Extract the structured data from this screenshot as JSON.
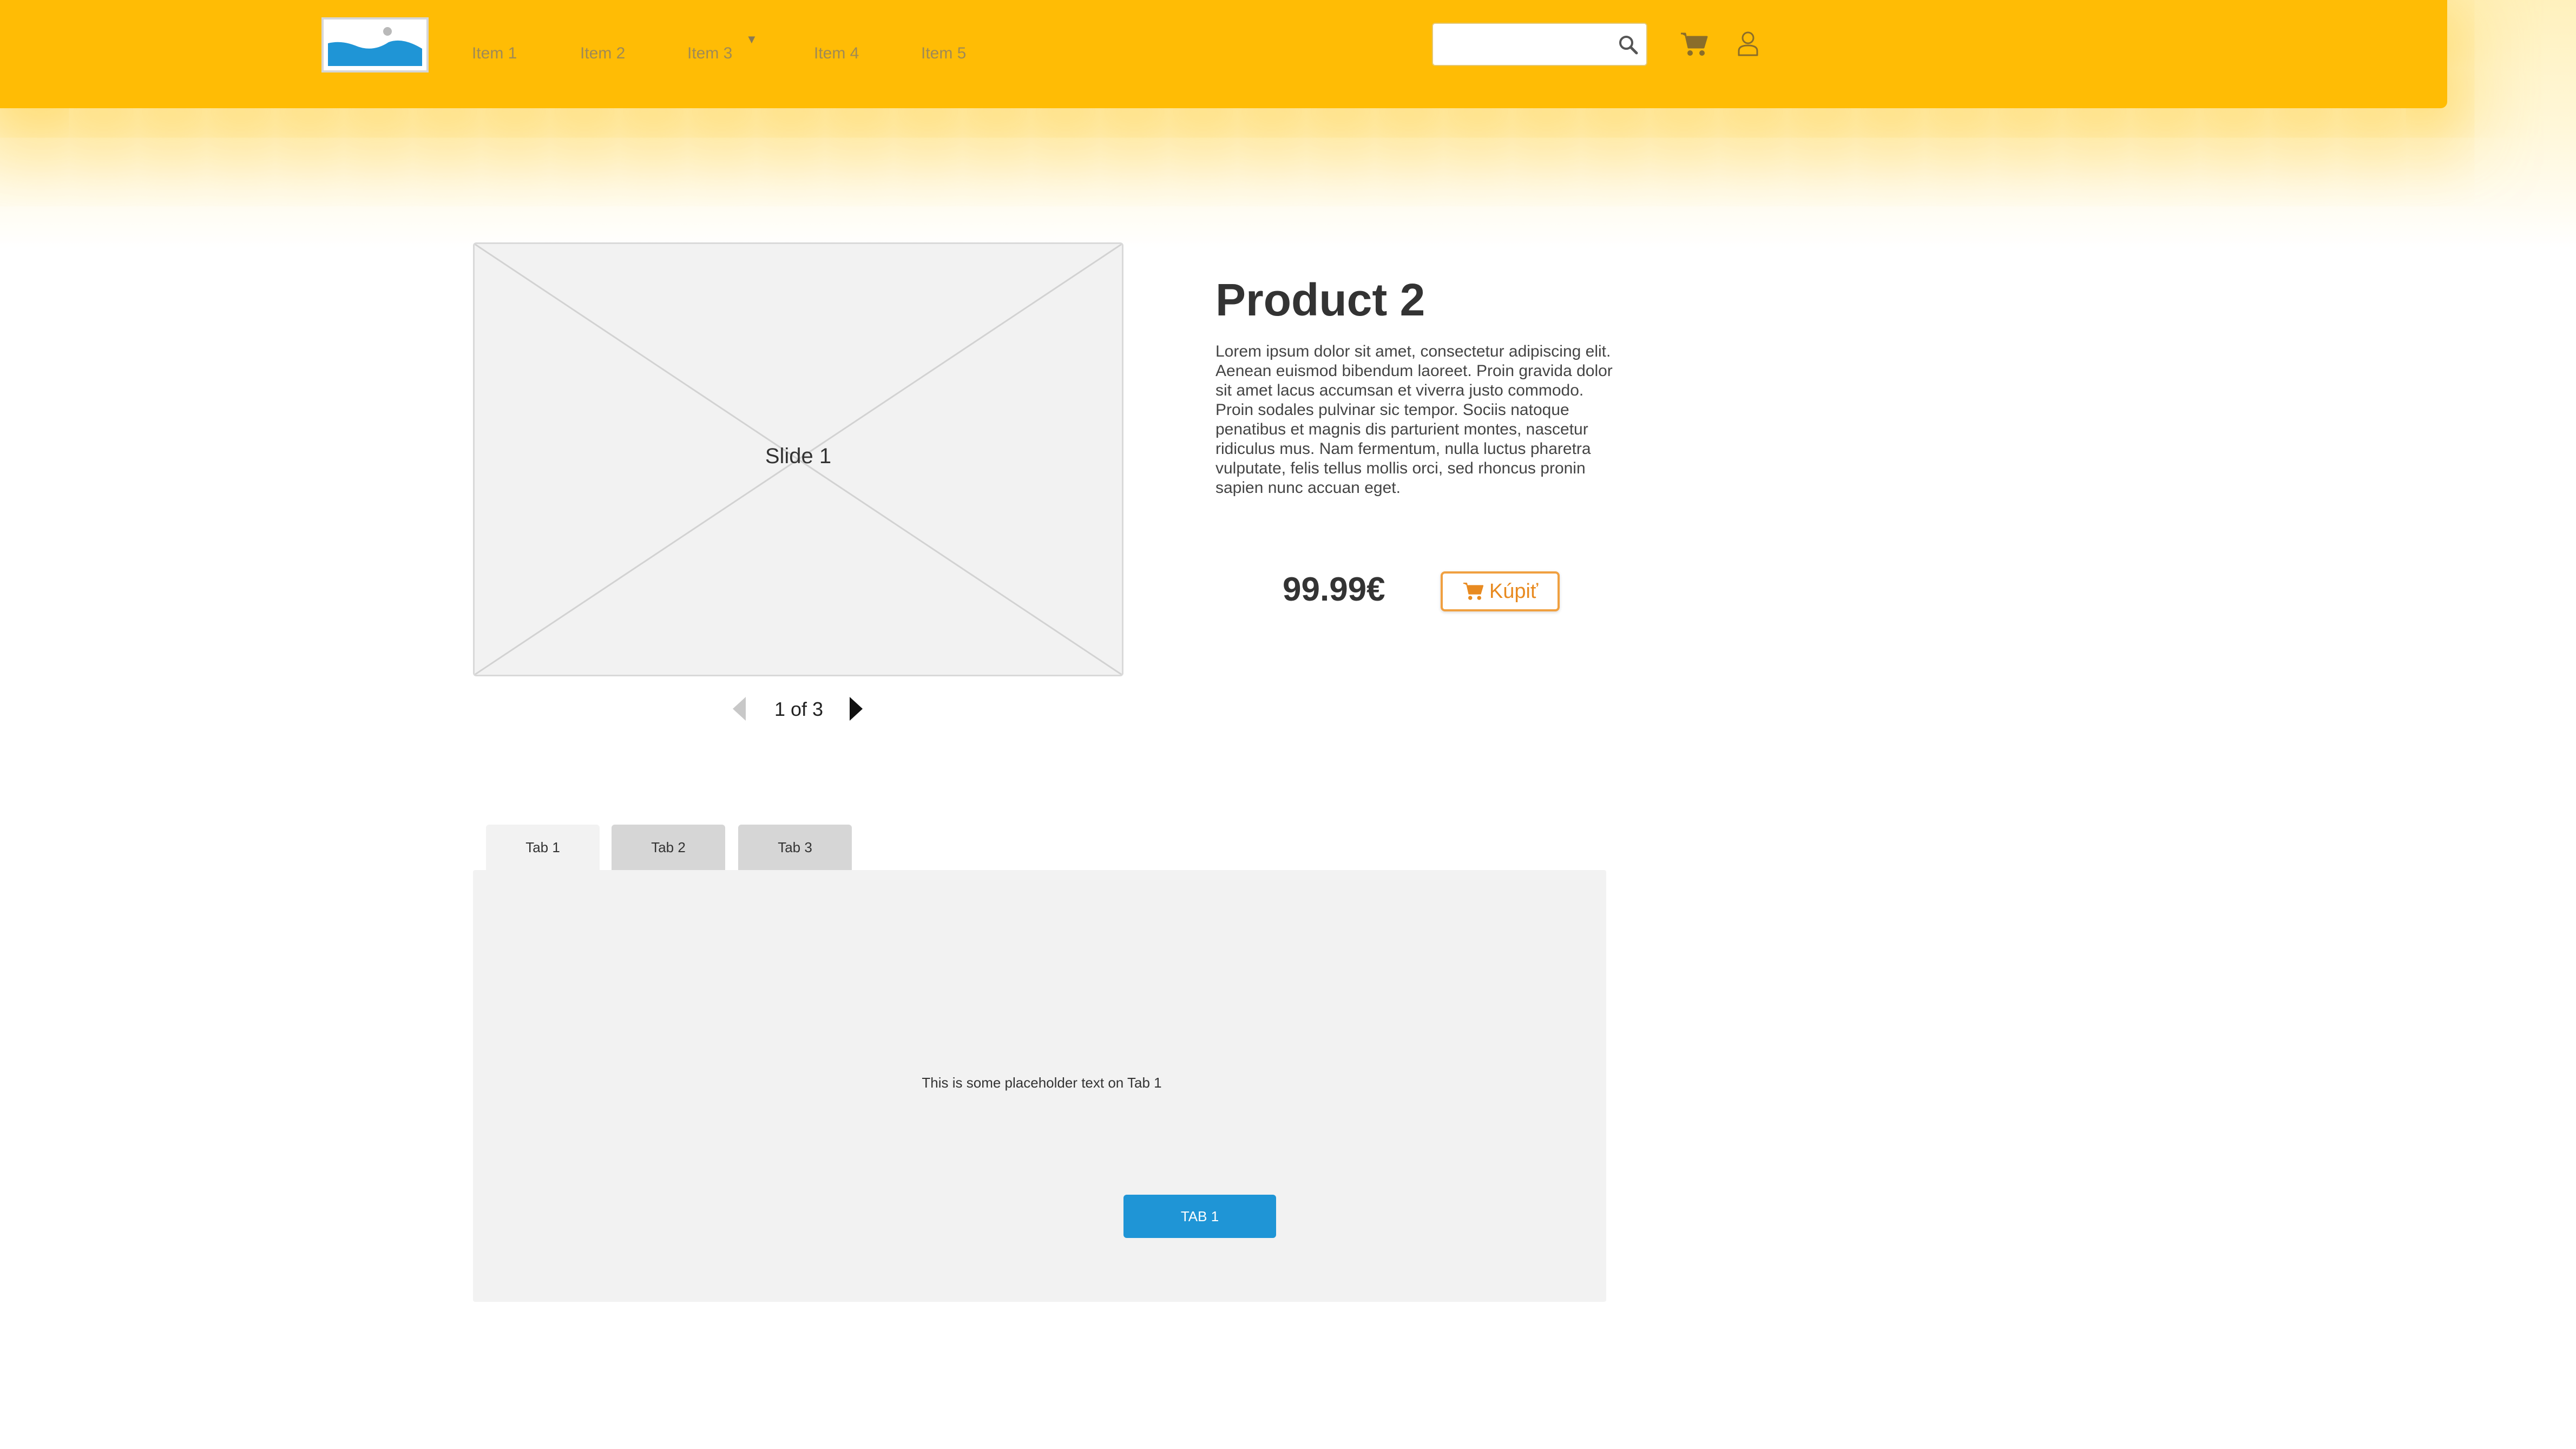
{
  "header": {
    "logo_icon": "image-placeholder-icon",
    "nav": [
      {
        "label": "Item 1"
      },
      {
        "label": "Item 2"
      },
      {
        "label": "Item 3",
        "has_dropdown": true
      },
      {
        "label": "Item 4"
      },
      {
        "label": "Item 5"
      }
    ],
    "search": {
      "value": "",
      "placeholder": "",
      "icon": "search-icon"
    },
    "cart_icon": "cart-icon",
    "user_icon": "user-icon",
    "colors": {
      "bar": "#ffbc05",
      "nav_text": "#a08a55"
    }
  },
  "slider": {
    "slide_label": "Slide 1",
    "pager": "1 of 3",
    "prev_icon": "chevron-left-icon",
    "next_icon": "chevron-right-icon"
  },
  "product": {
    "title": "Product 2",
    "description": "Lorem ipsum dolor sit amet, consectetur adipiscing elit. Aenean euismod bibendum laoreet. Proin gravida dolor sit amet lacus accumsan et viverra justo commodo. Proin sodales pulvinar sic tempor. Sociis natoque penatibus et magnis dis parturient montes, nascetur ridiculus mus. Nam fermentum, nulla luctus pharetra vulputate, felis tellus mollis orci, sed rhoncus pronin sapien nunc accuan eget.",
    "price": "99.99€",
    "buy_label": "Kúpiť",
    "buy_icon": "cart-icon",
    "colors": {
      "buy": "#e88a20"
    }
  },
  "tabs": {
    "items": [
      {
        "label": "Tab 1",
        "active": true
      },
      {
        "label": "Tab 2",
        "active": false
      },
      {
        "label": "Tab 3",
        "active": false
      }
    ],
    "panel_text": "This is some placeholder text on Tab 1",
    "panel_button": "TAB 1",
    "colors": {
      "button": "#1f95d6"
    }
  }
}
